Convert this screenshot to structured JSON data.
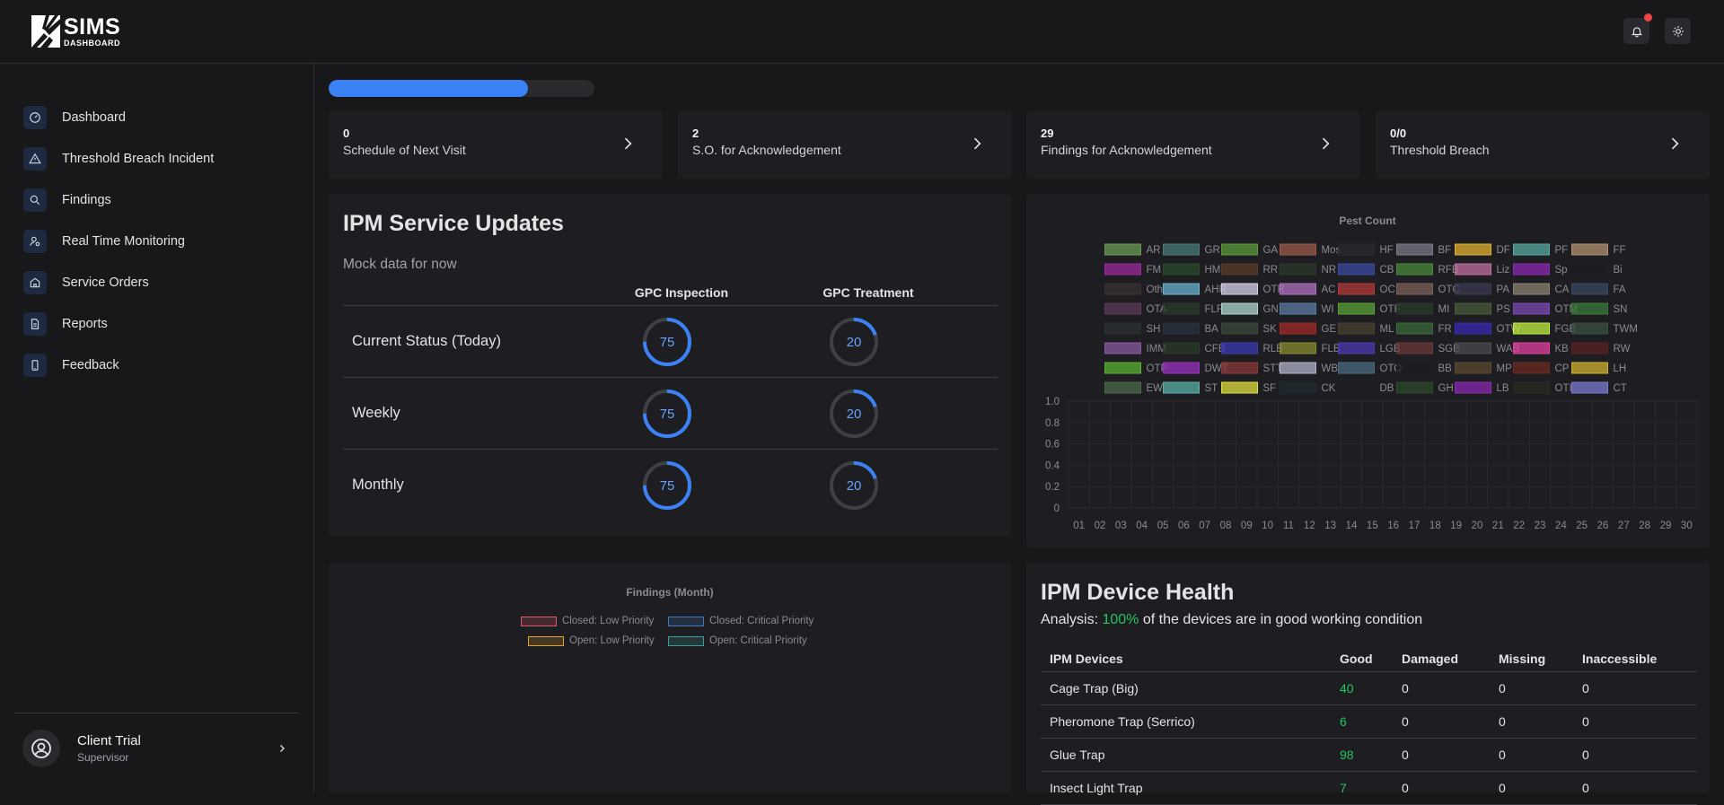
{
  "app": {
    "logo_text": "SIMS",
    "logo_sub": "DASHBOARD"
  },
  "sidebar": {
    "items": [
      {
        "label": "Dashboard",
        "icon": "gauge-icon"
      },
      {
        "label": "Threshold Breach Incident",
        "icon": "warning-icon"
      },
      {
        "label": "Findings",
        "icon": "search-icon"
      },
      {
        "label": "Real Time Monitoring",
        "icon": "user-monitor-icon"
      },
      {
        "label": "Service Orders",
        "icon": "building-icon"
      },
      {
        "label": "Reports",
        "icon": "document-icon"
      },
      {
        "label": "Feedback",
        "icon": "phone-icon"
      }
    ],
    "user": {
      "name": "Client Trial",
      "role": "Supervisor"
    }
  },
  "progress": {
    "value": 0.75,
    "color": "#3b82f6"
  },
  "cards": [
    {
      "value": "0",
      "label": "Schedule of Next Visit"
    },
    {
      "value": "2",
      "label": "S.O. for Acknowledgement"
    },
    {
      "value": "29",
      "label": "Findings for Acknowledgement"
    },
    {
      "value": "0/0",
      "label": "Threshold Breach"
    }
  ],
  "ipm": {
    "title": "IPM Service Updates",
    "subtitle": "Mock data for now",
    "columns": [
      "GPC Inspection",
      "GPC Treatment"
    ],
    "rows": [
      {
        "label": "Current Status (Today)",
        "inspection": 75,
        "treatment": 20
      },
      {
        "label": "Weekly",
        "inspection": 75,
        "treatment": 20
      },
      {
        "label": "Monthly",
        "inspection": 75,
        "treatment": 20
      }
    ],
    "gauge_color": "#3b82f6"
  },
  "chart_data": [
    {
      "type": "bar",
      "title": "Pest Count",
      "legend_position": "top",
      "series": [
        {
          "name": "AR",
          "color": "#6a9955"
        },
        {
          "name": "GR",
          "color": "#4a7a78"
        },
        {
          "name": "GA",
          "color": "#5a9a3a"
        },
        {
          "name": "Mos",
          "color": "#9a5a48"
        },
        {
          "name": "HF",
          "color": "#2a2a2e"
        },
        {
          "name": "BF",
          "color": "#7a7a8a"
        },
        {
          "name": "DF",
          "color": "#e0b030"
        },
        {
          "name": "PF",
          "color": "#5aaaa0"
        },
        {
          "name": "FF",
          "color": "#b09070"
        },
        {
          "name": "FM",
          "color": "#9a2a9a"
        },
        {
          "name": "HM",
          "color": "#2a4a2a"
        },
        {
          "name": "RR",
          "color": "#5a3a2a"
        },
        {
          "name": "NR",
          "color": "#2a3a2a"
        },
        {
          "name": "CB",
          "color": "#3a4aa0"
        },
        {
          "name": "RFB",
          "color": "#4a8a3a"
        },
        {
          "name": "Liz",
          "color": "#c070a0"
        },
        {
          "name": "Sp",
          "color": "#8a2ab0"
        },
        {
          "name": "Bi",
          "color": "#1e1e22"
        },
        {
          "name": "Oth",
          "color": "#3a3030"
        },
        {
          "name": "AHR",
          "color": "#6ab0d0"
        },
        {
          "name": "OTR",
          "color": "#d8d0e8"
        },
        {
          "name": "AC",
          "color": "#b070c0"
        },
        {
          "name": "OC",
          "color": "#b03a3a"
        },
        {
          "name": "OTC",
          "color": "#7a6058"
        },
        {
          "name": "PA",
          "color": "#3a3a50"
        },
        {
          "name": "CA",
          "color": "#8a8070"
        },
        {
          "name": "FA",
          "color": "#3a4a60"
        },
        {
          "name": "OTA",
          "color": "#5a3a5a"
        },
        {
          "name": "FLF",
          "color": "#2a3a2a"
        },
        {
          "name": "GN",
          "color": "#b0d8d0"
        },
        {
          "name": "WI",
          "color": "#5a7aa0"
        },
        {
          "name": "OTF",
          "color": "#5aa03a"
        },
        {
          "name": "MI",
          "color": "#2a3a2a"
        },
        {
          "name": "PS",
          "color": "#4a5a3a"
        },
        {
          "name": "OTM",
          "color": "#7a4ab0"
        },
        {
          "name": "SN",
          "color": "#3a7a3a"
        },
        {
          "name": "SH",
          "color": "#2a3030"
        },
        {
          "name": "BA",
          "color": "#2a3040"
        },
        {
          "name": "SK",
          "color": "#3a4a3a"
        },
        {
          "name": "GE",
          "color": "#a02a2a"
        },
        {
          "name": "ML",
          "color": "#4a4030"
        },
        {
          "name": "FR",
          "color": "#3a6a3a"
        },
        {
          "name": "OTW",
          "color": "#3a2ab0"
        },
        {
          "name": "FGB",
          "color": "#c0f040"
        },
        {
          "name": "TWM",
          "color": "#3a5040"
        },
        {
          "name": "IMM",
          "color": "#8a5aa0"
        },
        {
          "name": "CFB",
          "color": "#2a3a2a"
        },
        {
          "name": "RLB",
          "color": "#3a3ab0"
        },
        {
          "name": "FLB",
          "color": "#8a8a30"
        },
        {
          "name": "LGB",
          "color": "#4a3ab0"
        },
        {
          "name": "SGB",
          "color": "#6a3a3a"
        },
        {
          "name": "WAB",
          "color": "#4a4a50"
        },
        {
          "name": "KB",
          "color": "#e040a0"
        },
        {
          "name": "RW",
          "color": "#5a2020"
        },
        {
          "name": "OTP",
          "color": "#5ab030"
        },
        {
          "name": "DWT",
          "color": "#9a30c0"
        },
        {
          "name": "STT",
          "color": "#8a3a3a"
        },
        {
          "name": "WB",
          "color": "#b0b0c8"
        },
        {
          "name": "OTO",
          "color": "#4a6a80"
        },
        {
          "name": "BB",
          "color": "#1e1e22"
        },
        {
          "name": "MP",
          "color": "#5a4a30"
        },
        {
          "name": "CP",
          "color": "#6a2a20"
        },
        {
          "name": "LH",
          "color": "#d0b030"
        },
        {
          "name": "EW",
          "color": "#4a6a4a"
        },
        {
          "name": "ST",
          "color": "#5ab0a8"
        },
        {
          "name": "SF",
          "color": "#e0e040"
        },
        {
          "name": "CK",
          "color": "#1e2a2e"
        },
        {
          "name": "DB",
          "color": "#1e1e22"
        },
        {
          "name": "GH",
          "color": "#2a4a2a"
        },
        {
          "name": "LB",
          "color": "#8a2ab0"
        },
        {
          "name": "OTI",
          "color": "#2a2a22"
        },
        {
          "name": "CT",
          "color": "#7a7ad0"
        }
      ],
      "x": [
        "01",
        "02",
        "03",
        "04",
        "05",
        "06",
        "07",
        "08",
        "09",
        "10",
        "11",
        "12",
        "13",
        "14",
        "15",
        "16",
        "17",
        "18",
        "19",
        "20",
        "21",
        "22",
        "23",
        "24",
        "25",
        "26",
        "27",
        "28",
        "29",
        "30"
      ],
      "ylim": [
        0,
        1.0
      ],
      "yticks": [
        "1.0",
        "0.8",
        "0.6",
        "0.4",
        "0.2",
        "0"
      ],
      "grid": true
    },
    {
      "type": "bar",
      "title": "Findings (Month)",
      "legend_position": "top",
      "series": [
        {
          "name": "Closed: Low Priority",
          "color": "#e05a6a"
        },
        {
          "name": "Closed: Critical Priority",
          "color": "#3a7ac0"
        },
        {
          "name": "Open: Low Priority",
          "color": "#e0a030"
        },
        {
          "name": "Open: Critical Priority",
          "color": "#3aa09a"
        }
      ]
    }
  ],
  "device_health": {
    "title": "IPM Device Health",
    "analysis_prefix": "Analysis: ",
    "analysis_value": "100%",
    "analysis_suffix": " of the devices are in good working condition",
    "columns": [
      "IPM Devices",
      "Good",
      "Damaged",
      "Missing",
      "Inaccessible"
    ],
    "rows": [
      {
        "device": "Cage Trap (Big)",
        "good": "40",
        "damaged": "0",
        "missing": "0",
        "inaccessible": "0"
      },
      {
        "device": "Pheromone Trap (Serrico)",
        "good": "6",
        "damaged": "0",
        "missing": "0",
        "inaccessible": "0"
      },
      {
        "device": "Glue Trap",
        "good": "98",
        "damaged": "0",
        "missing": "0",
        "inaccessible": "0"
      },
      {
        "device": "Insect Light Trap",
        "good": "7",
        "damaged": "0",
        "missing": "0",
        "inaccessible": "0"
      }
    ]
  }
}
